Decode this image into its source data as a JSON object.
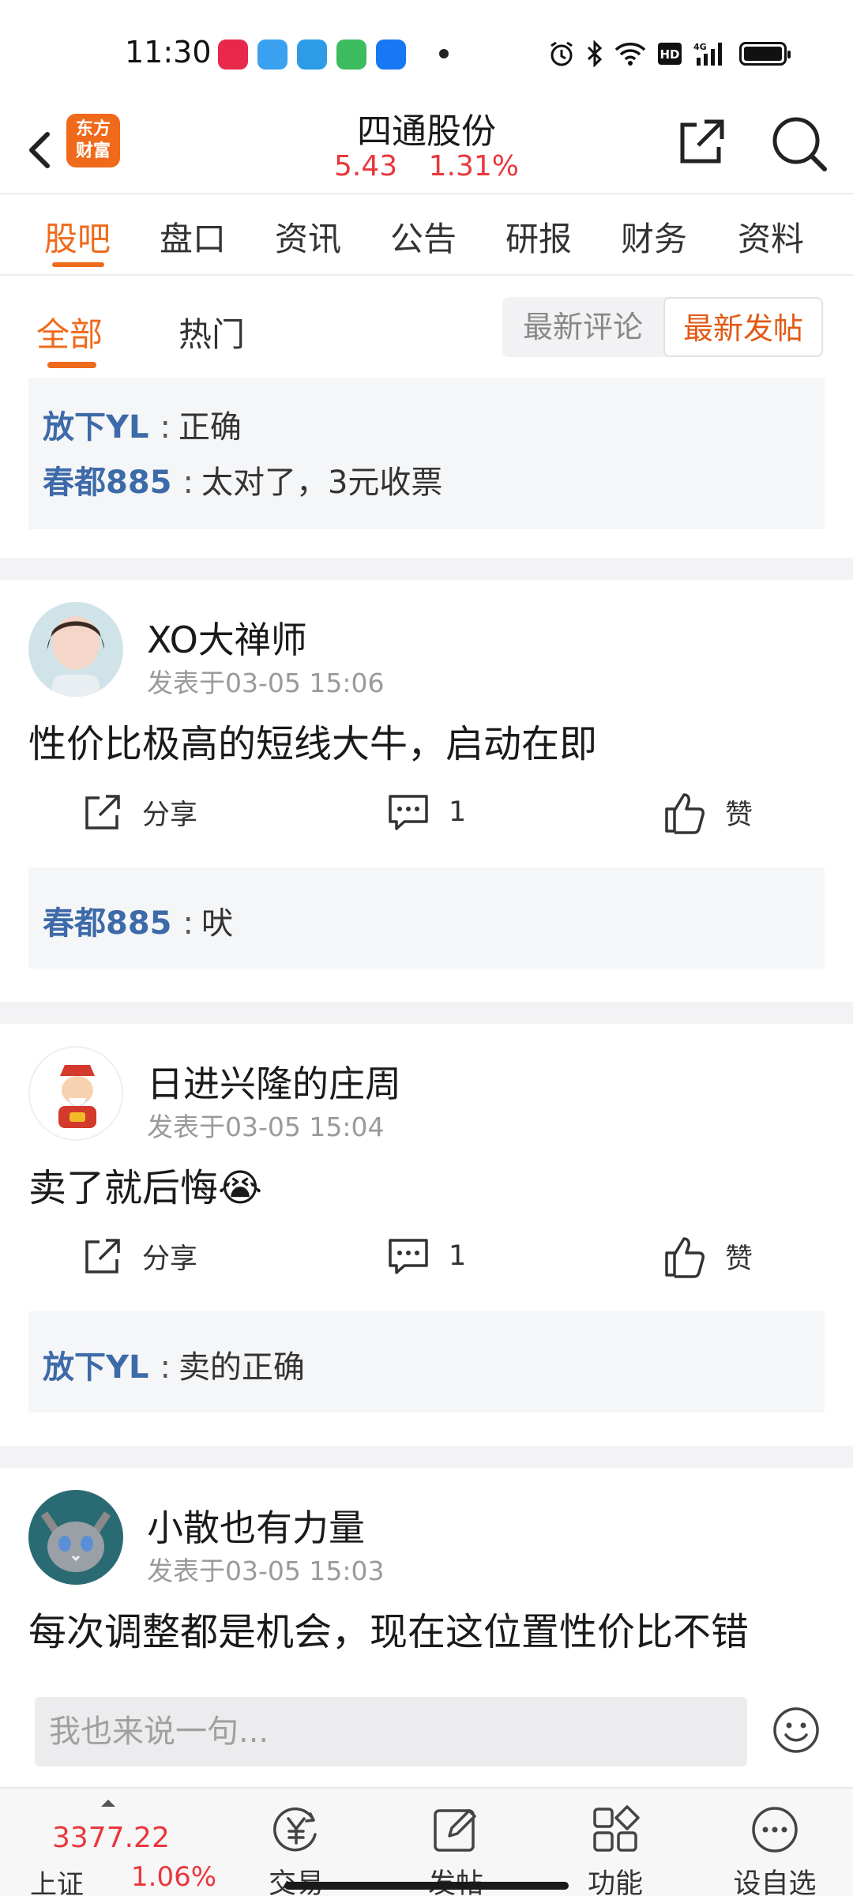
{
  "status_bar": {
    "time": "11:30"
  },
  "header": {
    "logo_line1": "东方",
    "logo_line2": "财富",
    "stock_name": "四通股份",
    "price": "5.43",
    "change_pct": "1.31%"
  },
  "tabs": [
    {
      "label": "股吧",
      "active": true
    },
    {
      "label": "盘口"
    },
    {
      "label": "资讯"
    },
    {
      "label": "公告"
    },
    {
      "label": "研报"
    },
    {
      "label": "财务"
    },
    {
      "label": "资料"
    }
  ],
  "subtabs": {
    "all": "全部",
    "hot": "热门",
    "latest_comment": "最新评论",
    "latest_post": "最新发帖"
  },
  "top_comments": [
    {
      "user": "放下YL",
      "text": "正确"
    },
    {
      "user": "春都885",
      "text": "太对了，3元收票"
    }
  ],
  "posts": [
    {
      "author": "XO大禅师",
      "time": "发表于03-05 15:06",
      "text": "性价比极高的短线大牛，启动在即",
      "share": "分享",
      "comments": "1",
      "like": "赞",
      "replies": [
        {
          "user": "春都885",
          "text": "吠"
        }
      ]
    },
    {
      "author": "日进兴隆的庄周",
      "time": "发表于03-05 15:04",
      "text": "卖了就后悔",
      "emoji": "😭",
      "share": "分享",
      "comments": "1",
      "like": "赞",
      "replies": [
        {
          "user": "放下YL",
          "text": "卖的正确"
        }
      ]
    },
    {
      "author": "小散也有力量",
      "time": "发表于03-05 15:03",
      "text": "每次调整都是机会，现在这位置性价比不错"
    }
  ],
  "reply_bar": {
    "placeholder": "我也来说一句..."
  },
  "bottom_nav": {
    "index_value": "3377.22",
    "index_name": "上证",
    "index_change": "1.06%",
    "items": [
      {
        "label": "交易",
        "icon": "yen-circle-icon"
      },
      {
        "label": "发帖",
        "icon": "edit-icon"
      },
      {
        "label": "功能",
        "icon": "grid-icon"
      },
      {
        "label": "设自选",
        "icon": "more-circle-icon"
      }
    ]
  },
  "colors": {
    "accent": "#f06a1b",
    "up_red": "#e8383d",
    "username_blue": "#3d6aa8"
  }
}
